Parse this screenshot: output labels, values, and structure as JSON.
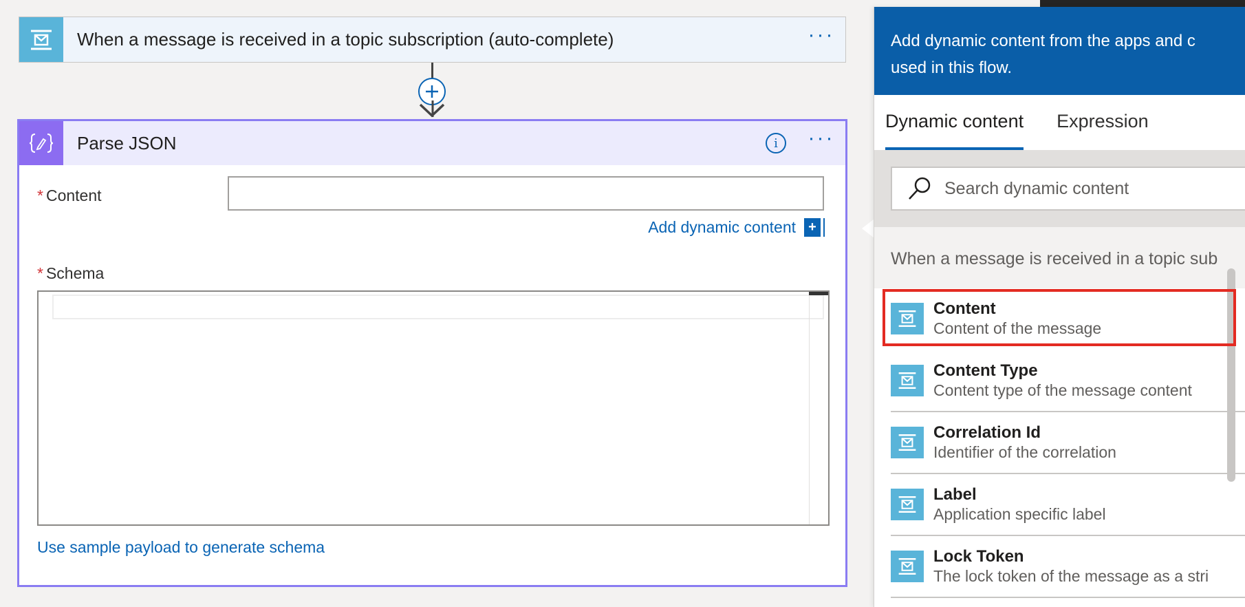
{
  "trigger": {
    "title": "When a message is received in a topic subscription (auto-complete)",
    "more": "···",
    "icon": "service-bus-icon",
    "icon_color": "#59b4d9"
  },
  "connector": {
    "add_icon": "plus-icon",
    "arrow_icon": "arrow-down-icon"
  },
  "parse_json": {
    "title": "Parse JSON",
    "icon": "braces-pencil-icon",
    "icon_color": "#8c6cf1",
    "info": "i",
    "more": "···",
    "content_label": "Content",
    "schema_label": "Schema",
    "required_mark": "*",
    "add_dynamic_label": "Add dynamic content",
    "add_dynamic_plus": "+",
    "sample_payload_link": "Use sample payload to generate schema",
    "content_value": ""
  },
  "panel": {
    "header_text_line1": "Add dynamic content from the apps and c",
    "header_text_line2": "used in this flow.",
    "tabs": [
      {
        "label": "Dynamic content",
        "active": true
      },
      {
        "label": "Expression",
        "active": false
      }
    ],
    "search_placeholder": "Search dynamic content",
    "section_title": "When a message is received in a topic sub",
    "items": [
      {
        "name": "Content",
        "description": "Content of the message"
      },
      {
        "name": "Content Type",
        "description": "Content type of the message content"
      },
      {
        "name": "Correlation Id",
        "description": "Identifier of the correlation"
      },
      {
        "name": "Label",
        "description": "Application specific label"
      },
      {
        "name": "Lock Token",
        "description": "The lock token of the message as a stri"
      }
    ],
    "accent_color": "#0a5ea8",
    "highlight_color": "#e32b22"
  }
}
